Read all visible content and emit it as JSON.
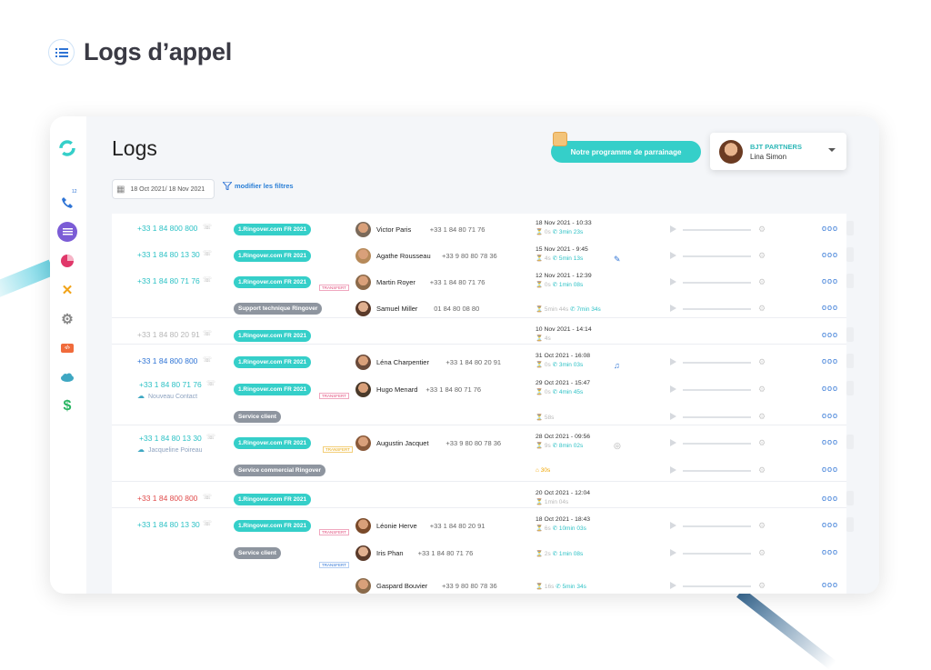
{
  "page": {
    "title": "Logs d’appel"
  },
  "app": {
    "title": "Logs",
    "nav_badge": "12",
    "date_range": "18 Oct 2021/ 18 Nov 2021",
    "filter_label": "modifier les filtres",
    "promo_label": "Notre programme de parrainage",
    "user": {
      "org": "BJT PARTNERS",
      "name": "Lina Simon"
    }
  },
  "calls": [
    {
      "number": "+33 1 84 800 800",
      "tag": "1.Ringover.com FR 2021",
      "contact": "Victor Paris",
      "phone": "+33 1 84 80 71 76",
      "date": "18 Nov 2021 - 10:33",
      "wait": "0s",
      "talk": "3min 23s"
    },
    {
      "number": "+33 1 84 80 13 30",
      "tag": "1.Ringover.com FR 2021",
      "contact": "Agathe Rousseau",
      "phone": "+33 9 80 80 78 36",
      "date": "15 Nov 2021 - 9:45",
      "wait": "4s",
      "talk": "5min 13s"
    },
    {
      "number": "+33 1 84 80 71 76",
      "tag": "1.Ringover.com FR 2021",
      "contact": "Martin Royer",
      "phone": "+33 1 84 80 71 76",
      "date": "12 Nov 2021 - 12:39",
      "wait": "0s",
      "talk": "1min 08s",
      "transfer": {
        "tag": "Support technique Ringover",
        "contact": "Samuel Miller",
        "phone": "01 84 80 08 80",
        "wait": "5min 44s",
        "talk": "7min 34s",
        "label": "TRANSFERT"
      }
    },
    {
      "number": "+33 1 84 80 20 91",
      "tag": "1.Ringover.com FR 2021",
      "date": "10 Nov 2021 - 14:14",
      "wait": "4s"
    },
    {
      "number": "+33 1 84 800 800",
      "tag": "1.Ringover.com FR 2021",
      "contact": "Léna Charpentier",
      "phone": "+33 1 84 80 20 91",
      "date": "31 Oct 2021 - 16:08",
      "wait": "0s",
      "talk": "3min 03s"
    },
    {
      "number": "+33 1 84 80 71 76",
      "sub": "Nouveau Contact",
      "tag": "1.Ringover.com FR 2021",
      "contact": "Hugo Menard",
      "phone": "+33 1 84 80 71 76",
      "date": "29 Oct 2021 - 15:47",
      "wait": "0s",
      "talk": "4min 45s",
      "transfer": {
        "tag": "Service client",
        "wait": "58s",
        "label": "TRANSFERT"
      }
    },
    {
      "number": "+33 1 84 80 13 30",
      "sub": "Jacqueline Poireau",
      "tag": "1.Ringover.com FR 2021",
      "contact": "Augustin Jacquet",
      "phone": "+33 9 80 80 78 36",
      "date": "28 Oct 2021 - 09:56",
      "wait": "9s",
      "talk": "8min 02s",
      "transfer": {
        "tag": "Service commercial Ringover",
        "voicemail": "30s",
        "label": "TRANSFERT"
      }
    },
    {
      "number": "+33 1 84 800 800",
      "tag": "1.Ringover.com FR 2021",
      "date": "20 Oct 2021 - 12:04",
      "wait": "1min 04s"
    },
    {
      "number": "+33 1 84 80 13 30",
      "tag": "1.Ringover.com FR 2021",
      "contact": "Léonie Herve",
      "phone": "+33 1 84 80 20 91",
      "date": "18 Oct 2021 - 18:43",
      "wait": "6s",
      "talk": "10min 03s",
      "transfer": {
        "tag": "Service client",
        "contact": "Iris Phan",
        "phone": "+33 1 84 80 71 76",
        "wait": "2s",
        "talk": "1min 08s",
        "label": "TRANSFERT"
      },
      "transfer2": {
        "contact": "Gaspard Bouvier",
        "phone": "+33 9 80 80 78 36",
        "wait": "16s",
        "talk": "5min 34s",
        "label": "TRANSFERT"
      }
    }
  ],
  "colors": {
    "teal": "#35cfc9",
    "blue": "#2f74d5",
    "red": "#e04b4b",
    "gray_tag": "#8e959f"
  }
}
